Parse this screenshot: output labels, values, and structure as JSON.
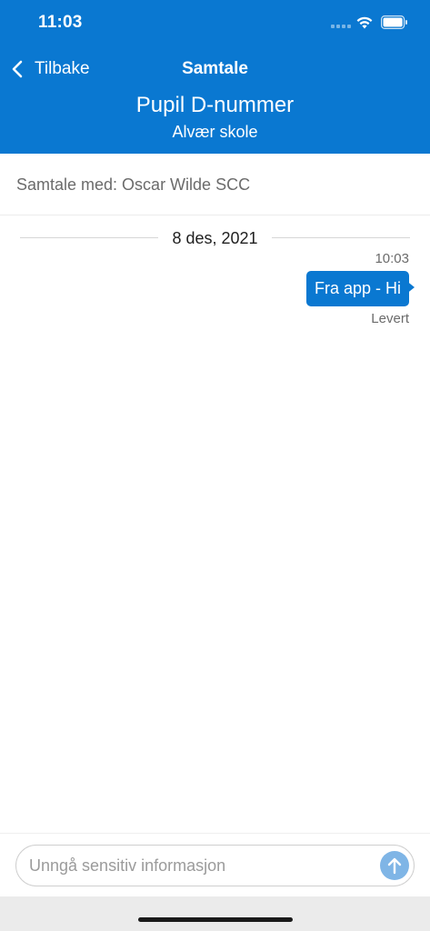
{
  "status_bar": {
    "time": "11:03"
  },
  "nav": {
    "back_label": "Tilbake",
    "title": "Samtale"
  },
  "header": {
    "title": "Pupil D-nummer",
    "subtitle": "Alvær skole"
  },
  "conversation": {
    "with_label": "Samtale med: Oscar Wilde SCC"
  },
  "messages": {
    "date": "8 des, 2021",
    "items": [
      {
        "time": "10:03",
        "text": "Fra app - Hi",
        "status": "Levert",
        "direction": "outgoing"
      }
    ]
  },
  "composer": {
    "placeholder": "Unngå sensitiv informasjon",
    "value": ""
  },
  "icons": {
    "back": "chevron-left-icon",
    "send": "arrow-up-icon",
    "wifi": "wifi-icon",
    "battery": "battery-icon",
    "signal": "signal-icon"
  },
  "colors": {
    "primary": "#0a78d1",
    "send_button": "#7fb5e6",
    "muted_text": "#6b6b6b"
  }
}
